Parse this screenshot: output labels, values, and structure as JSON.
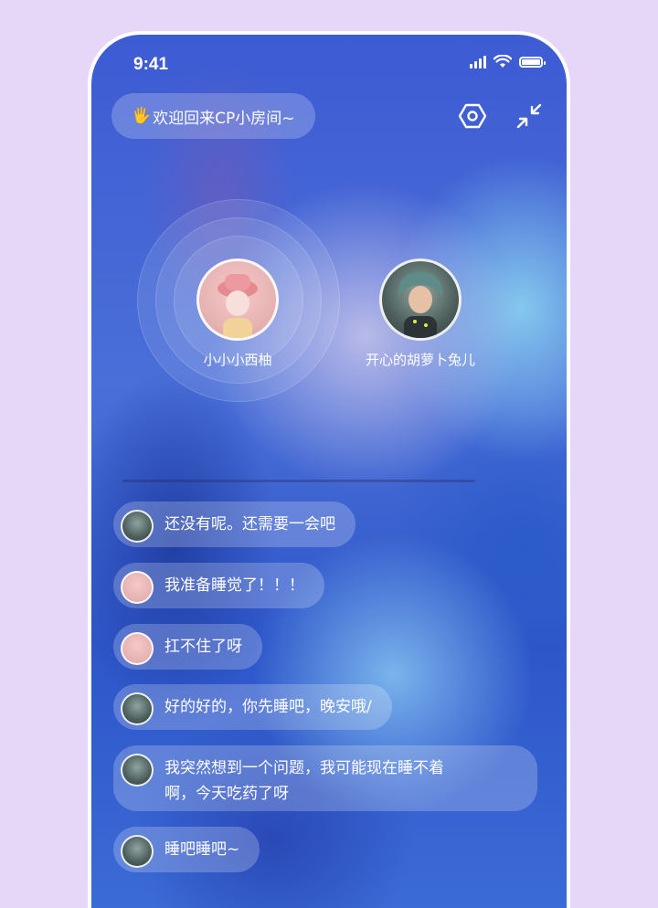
{
  "status_bar": {
    "time": "9:41"
  },
  "header": {
    "welcome_emoji": "🖐",
    "welcome_text": "欢迎回来CP小房间~",
    "settings_icon": "hexagon-settings-icon",
    "minimize_icon": "collapse-arrows-icon"
  },
  "seats": [
    {
      "name": "小小小西柚",
      "avatar": "pink-hat-character",
      "speaking": true
    },
    {
      "name": "开心的胡萝卜兔儿",
      "avatar": "teal-hair-character",
      "speaking": false
    }
  ],
  "messages": [
    {
      "avatar": "teal-hair-character",
      "text": "还没有呢。还需要一会吧"
    },
    {
      "avatar": "pink-hat-character",
      "text": "我准备睡觉了！！！"
    },
    {
      "avatar": "pink-hat-character",
      "text": "扛不住了呀"
    },
    {
      "avatar": "teal-hair-character",
      "text": "好的好的，你先睡吧，晚安哦/"
    },
    {
      "avatar": "teal-hair-character",
      "text_line1": "我突然想到一个问题，我可能现在睡不着",
      "text_line2": "啊，今天吃药了呀"
    },
    {
      "avatar": "teal-hair-character",
      "text": "睡吧睡吧~"
    }
  ],
  "colors": {
    "page_bg": "#e6d6f7",
    "bubble_bg": "rgba(255,255,255,0.22)",
    "text": "#ffffff"
  }
}
